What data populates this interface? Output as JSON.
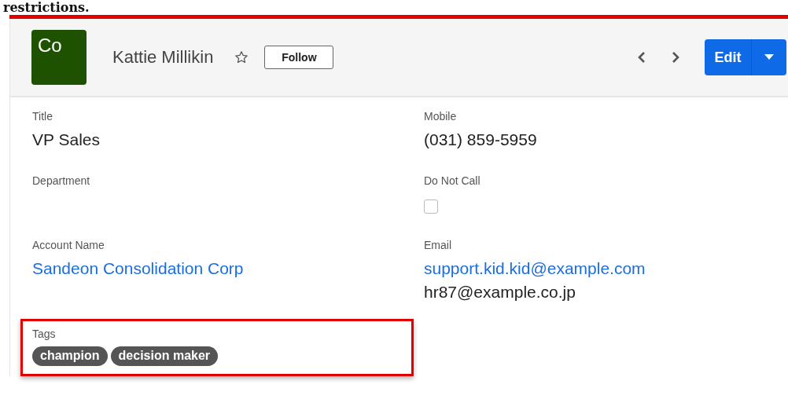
{
  "caption": "restrictions.",
  "header": {
    "avatar_text": "Co",
    "name": "Kattie Millikin",
    "starred": false,
    "follow_label": "Follow",
    "edit_label": "Edit"
  },
  "fields": [
    {
      "kind": "text",
      "label": "Title",
      "value": "VP Sales"
    },
    {
      "kind": "text",
      "label": "Mobile",
      "value": "(031) 859-5959"
    },
    {
      "kind": "text",
      "label": "Department"
    },
    {
      "kind": "checkbox",
      "label": "Do Not Call",
      "checked": false
    },
    {
      "kind": "links",
      "label": "Account Name",
      "values": [
        {
          "text": "Sandeon Consolidation Corp",
          "link": true
        }
      ]
    },
    {
      "kind": "links",
      "label": "Email",
      "values": [
        {
          "text": "support.kid.kid@example.com",
          "link": true
        },
        {
          "text": "hr87@example.co.jp",
          "link": false
        }
      ]
    },
    {
      "kind": "tags",
      "label": "Tags",
      "highlighted": true,
      "tags": [
        "champion",
        "decision maker"
      ]
    }
  ]
}
